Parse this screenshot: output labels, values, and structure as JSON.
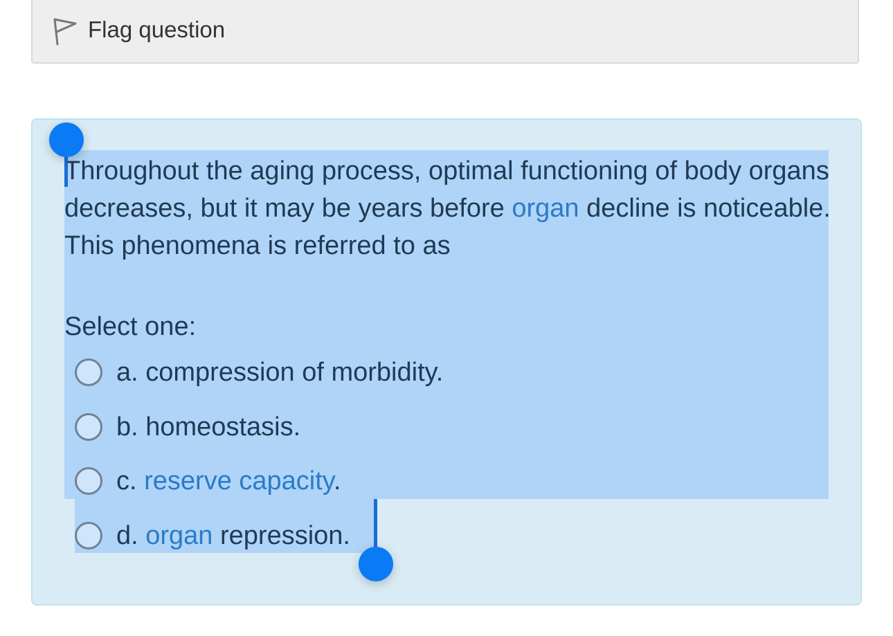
{
  "flag": {
    "label": "Flag question",
    "icon": "flag-outline-icon"
  },
  "question": {
    "text_part1": "Throughout the aging process, optimal functioning of body organs decreases, but it may be years before ",
    "text_link": "organ",
    "text_part2": " decline is noticeable. This phenomena is referred to as",
    "prompt": "Select one:",
    "options": [
      {
        "prefix": "a. ",
        "text": "compression of morbidity.",
        "link": "",
        "suffix": ""
      },
      {
        "prefix": "b. ",
        "text": "homeostasis.",
        "link": "",
        "suffix": ""
      },
      {
        "prefix": "c. ",
        "text": "",
        "link": "reserve capacity",
        "suffix": "."
      },
      {
        "prefix": "d. ",
        "text": "",
        "link": "organ",
        "suffix": " repression."
      }
    ]
  },
  "colors": {
    "selection": "#b0d4f7",
    "box_bg": "#d9ecf6",
    "link": "#2a7bc8",
    "handle": "#0a7af5"
  }
}
